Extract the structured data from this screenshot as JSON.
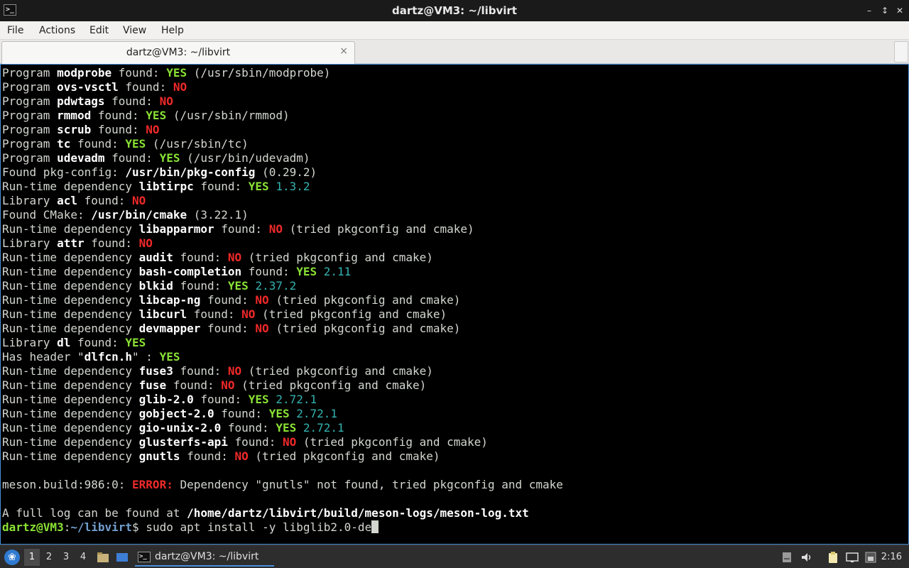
{
  "window": {
    "title": "dartz@VM3: ~/libvirt",
    "icon": "terminal-icon"
  },
  "menu": [
    "File",
    "Actions",
    "Edit",
    "View",
    "Help"
  ],
  "tab": {
    "label": "dartz@VM3: ~/libvirt",
    "close": "×"
  },
  "terminal": {
    "lines": [
      [
        [
          "",
          "Program "
        ],
        [
          "b",
          "modprobe"
        ],
        [
          "",
          " found: "
        ],
        [
          "yes",
          "YES"
        ],
        [
          "",
          " (/usr/sbin/modprobe)"
        ]
      ],
      [
        [
          "",
          "Program "
        ],
        [
          "b",
          "ovs-vsctl"
        ],
        [
          "",
          " found: "
        ],
        [
          "no",
          "NO"
        ]
      ],
      [
        [
          "",
          "Program "
        ],
        [
          "b",
          "pdwtags"
        ],
        [
          "",
          " found: "
        ],
        [
          "no",
          "NO"
        ]
      ],
      [
        [
          "",
          "Program "
        ],
        [
          "b",
          "rmmod"
        ],
        [
          "",
          " found: "
        ],
        [
          "yes",
          "YES"
        ],
        [
          "",
          " (/usr/sbin/rmmod)"
        ]
      ],
      [
        [
          "",
          "Program "
        ],
        [
          "b",
          "scrub"
        ],
        [
          "",
          " found: "
        ],
        [
          "no",
          "NO"
        ]
      ],
      [
        [
          "",
          "Program "
        ],
        [
          "b",
          "tc"
        ],
        [
          "",
          " found: "
        ],
        [
          "yes",
          "YES"
        ],
        [
          "",
          " (/usr/sbin/tc)"
        ]
      ],
      [
        [
          "",
          "Program "
        ],
        [
          "b",
          "udevadm"
        ],
        [
          "",
          " found: "
        ],
        [
          "yes",
          "YES"
        ],
        [
          "",
          " (/usr/bin/udevadm)"
        ]
      ],
      [
        [
          "",
          "Found pkg-config: "
        ],
        [
          "b",
          "/usr/bin/pkg-config"
        ],
        [
          "",
          " (0.29.2)"
        ]
      ],
      [
        [
          "",
          "Run-time dependency "
        ],
        [
          "b",
          "libtirpc"
        ],
        [
          "",
          " found: "
        ],
        [
          "yes",
          "YES"
        ],
        [
          "",
          " "
        ],
        [
          "ver",
          "1.3.2"
        ]
      ],
      [
        [
          "",
          "Library "
        ],
        [
          "b",
          "acl"
        ],
        [
          "",
          " found: "
        ],
        [
          "no",
          "NO"
        ]
      ],
      [
        [
          "",
          "Found CMake: "
        ],
        [
          "b",
          "/usr/bin/cmake"
        ],
        [
          "",
          " (3.22.1)"
        ]
      ],
      [
        [
          "",
          "Run-time dependency "
        ],
        [
          "b",
          "libapparmor"
        ],
        [
          "",
          " found: "
        ],
        [
          "no",
          "NO"
        ],
        [
          "",
          " (tried pkgconfig and cmake)"
        ]
      ],
      [
        [
          "",
          "Library "
        ],
        [
          "b",
          "attr"
        ],
        [
          "",
          " found: "
        ],
        [
          "no",
          "NO"
        ]
      ],
      [
        [
          "",
          "Run-time dependency "
        ],
        [
          "b",
          "audit"
        ],
        [
          "",
          " found: "
        ],
        [
          "no",
          "NO"
        ],
        [
          "",
          " (tried pkgconfig and cmake)"
        ]
      ],
      [
        [
          "",
          "Run-time dependency "
        ],
        [
          "b",
          "bash-completion"
        ],
        [
          "",
          " found: "
        ],
        [
          "yes",
          "YES"
        ],
        [
          "",
          " "
        ],
        [
          "ver",
          "2.11"
        ]
      ],
      [
        [
          "",
          "Run-time dependency "
        ],
        [
          "b",
          "blkid"
        ],
        [
          "",
          " found: "
        ],
        [
          "yes",
          "YES"
        ],
        [
          "",
          " "
        ],
        [
          "ver",
          "2.37.2"
        ]
      ],
      [
        [
          "",
          "Run-time dependency "
        ],
        [
          "b",
          "libcap-ng"
        ],
        [
          "",
          " found: "
        ],
        [
          "no",
          "NO"
        ],
        [
          "",
          " (tried pkgconfig and cmake)"
        ]
      ],
      [
        [
          "",
          "Run-time dependency "
        ],
        [
          "b",
          "libcurl"
        ],
        [
          "",
          " found: "
        ],
        [
          "no",
          "NO"
        ],
        [
          "",
          " (tried pkgconfig and cmake)"
        ]
      ],
      [
        [
          "",
          "Run-time dependency "
        ],
        [
          "b",
          "devmapper"
        ],
        [
          "",
          " found: "
        ],
        [
          "no",
          "NO"
        ],
        [
          "",
          " (tried pkgconfig and cmake)"
        ]
      ],
      [
        [
          "",
          "Library "
        ],
        [
          "b",
          "dl"
        ],
        [
          "",
          " found: "
        ],
        [
          "yes",
          "YES"
        ]
      ],
      [
        [
          "",
          "Has header \""
        ],
        [
          "b",
          "dlfcn.h"
        ],
        [
          "",
          "\" : "
        ],
        [
          "yes",
          "YES"
        ]
      ],
      [
        [
          "",
          "Run-time dependency "
        ],
        [
          "b",
          "fuse3"
        ],
        [
          "",
          " found: "
        ],
        [
          "no",
          "NO"
        ],
        [
          "",
          " (tried pkgconfig and cmake)"
        ]
      ],
      [
        [
          "",
          "Run-time dependency "
        ],
        [
          "b",
          "fuse"
        ],
        [
          "",
          " found: "
        ],
        [
          "no",
          "NO"
        ],
        [
          "",
          " (tried pkgconfig and cmake)"
        ]
      ],
      [
        [
          "",
          "Run-time dependency "
        ],
        [
          "b",
          "glib-2.0"
        ],
        [
          "",
          " found: "
        ],
        [
          "yes",
          "YES"
        ],
        [
          "",
          " "
        ],
        [
          "ver",
          "2.72.1"
        ]
      ],
      [
        [
          "",
          "Run-time dependency "
        ],
        [
          "b",
          "gobject-2.0"
        ],
        [
          "",
          " found: "
        ],
        [
          "yes",
          "YES"
        ],
        [
          "",
          " "
        ],
        [
          "ver",
          "2.72.1"
        ]
      ],
      [
        [
          "",
          "Run-time dependency "
        ],
        [
          "b",
          "gio-unix-2.0"
        ],
        [
          "",
          " found: "
        ],
        [
          "yes",
          "YES"
        ],
        [
          "",
          " "
        ],
        [
          "ver",
          "2.72.1"
        ]
      ],
      [
        [
          "",
          "Run-time dependency "
        ],
        [
          "b",
          "glusterfs-api"
        ],
        [
          "",
          " found: "
        ],
        [
          "no",
          "NO"
        ],
        [
          "",
          " (tried pkgconfig and cmake)"
        ]
      ],
      [
        [
          "",
          "Run-time dependency "
        ],
        [
          "b",
          "gnutls"
        ],
        [
          "",
          " found: "
        ],
        [
          "no",
          "NO"
        ],
        [
          "",
          " (tried pkgconfig and cmake)"
        ]
      ],
      [],
      [
        [
          "",
          "meson.build:986:0: "
        ],
        [
          "err",
          "ERROR:"
        ],
        [
          "",
          " Dependency \"gnutls\" not found, tried pkgconfig and cmake"
        ]
      ],
      [],
      [
        [
          "",
          "A full log can be found at "
        ],
        [
          "b",
          "/home/dartz/libvirt/build/meson-logs/meson-log.txt"
        ]
      ],
      [
        [
          "pu",
          "dartz@VM3"
        ],
        [
          "",
          ":"
        ],
        [
          "pp",
          "~/libvirt"
        ],
        [
          "",
          "$ sudo apt install -y libglib2.0-de"
        ]
      ]
    ]
  },
  "taskbar": {
    "start_icon": "menu-icon",
    "workspaces": [
      "1",
      "2",
      "3",
      "4"
    ],
    "active_workspace": "1",
    "task_label": "dartz@VM3: ~/libvirt",
    "clock": "2:16",
    "tray_icons": [
      "removable-media-icon",
      "volume-icon",
      "clipboard-icon",
      "display-icon",
      "network-icon"
    ]
  }
}
